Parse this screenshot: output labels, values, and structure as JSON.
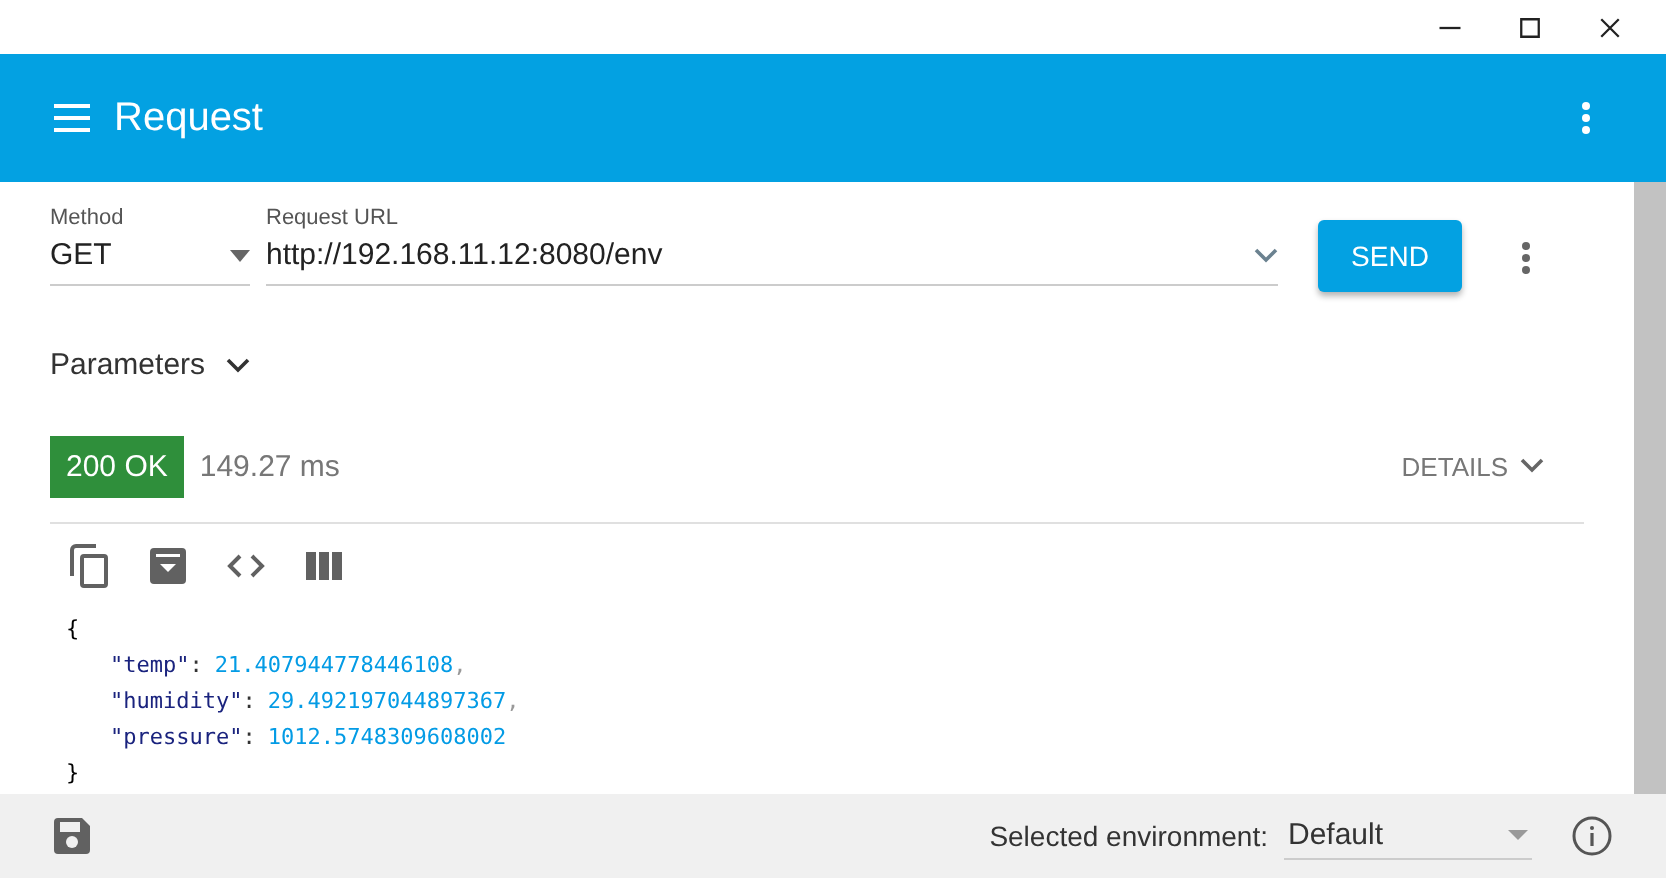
{
  "app_bar": {
    "title": "Request"
  },
  "request": {
    "method_label": "Method",
    "method": "GET",
    "url_label": "Request URL",
    "url": "http://192.168.11.12:8080/env",
    "send": "SEND"
  },
  "parameters": {
    "label": "Parameters",
    "expanded": false
  },
  "response": {
    "status": "200 OK",
    "time": "149.27 ms",
    "details": "DETAILS",
    "body": {
      "open": "{",
      "close": "}",
      "colon": ":",
      "entries": [
        {
          "key": "\"temp\"",
          "value": "21.407944778446108",
          "separator": ","
        },
        {
          "key": "\"humidity\"",
          "value": "29.492197044897367",
          "separator": ","
        },
        {
          "key": "\"pressure\"",
          "value": "1012.5748309608002"
        }
      ]
    }
  },
  "footer": {
    "env_label": "Selected environment:",
    "env": "Default"
  }
}
